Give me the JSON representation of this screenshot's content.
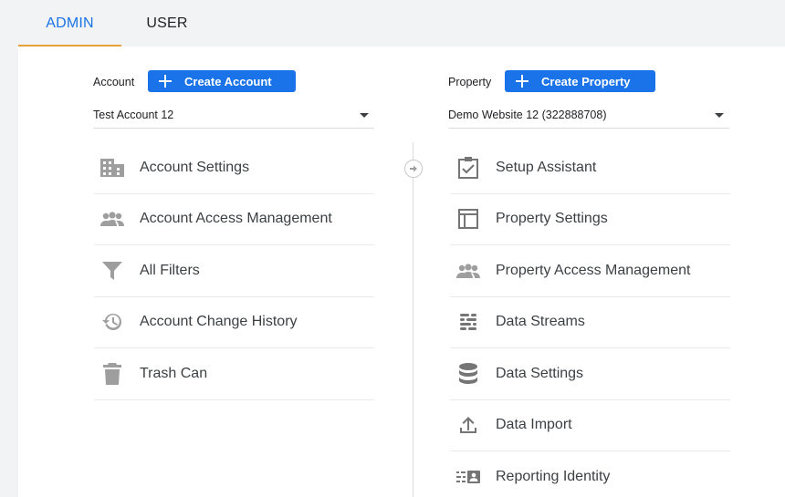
{
  "tabs": {
    "admin": "ADMIN",
    "user": "USER"
  },
  "account": {
    "label": "Account",
    "create_label": "Create Account",
    "selected": "Test Account 12",
    "items": [
      {
        "label": "Account Settings",
        "icon": "building-icon"
      },
      {
        "label": "Account Access Management",
        "icon": "people-icon"
      },
      {
        "label": "All Filters",
        "icon": "filter-icon"
      },
      {
        "label": "Account Change History",
        "icon": "history-icon"
      },
      {
        "label": "Trash Can",
        "icon": "trash-icon"
      }
    ]
  },
  "property": {
    "label": "Property",
    "create_label": "Create Property",
    "selected": "Demo Website 12 (322888708)",
    "items": [
      {
        "label": "Setup Assistant",
        "icon": "checkbox-icon"
      },
      {
        "label": "Property Settings",
        "icon": "layout-icon"
      },
      {
        "label": "Property Access Management",
        "icon": "people-icon"
      },
      {
        "label": "Data Streams",
        "icon": "streams-icon"
      },
      {
        "label": "Data Settings",
        "icon": "database-icon"
      },
      {
        "label": "Data Import",
        "icon": "upload-icon"
      },
      {
        "label": "Reporting Identity",
        "icon": "identity-icon"
      }
    ]
  },
  "colors": {
    "accent": "#1a73e8",
    "tab_underline": "#e8a13a",
    "icon": "#757575"
  }
}
